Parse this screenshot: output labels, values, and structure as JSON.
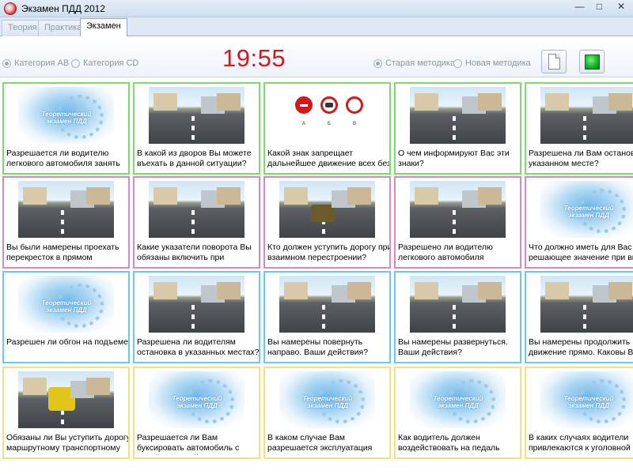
{
  "window": {
    "title": "Экзамен ПДД 2012"
  },
  "tabs": [
    {
      "label": "Теория",
      "active": false
    },
    {
      "label": "Практика",
      "active": false
    },
    {
      "label": "Экзамен",
      "active": true
    }
  ],
  "toolbar": {
    "category_ab": "Категория АВ",
    "category_cd": "Категория CD",
    "timer": "19:55",
    "method_old": "Старая методика",
    "method_new": "Новая методика",
    "doc_icon": "document-icon",
    "stop_icon": "green-square-icon"
  },
  "logo_text": "Теоретический экзамен ПДД",
  "sign_labels": [
    "А",
    "Б",
    "В"
  ],
  "row_colors": [
    "#7bdc6b",
    "#d58ac7",
    "#68c8ef",
    "#eee37e"
  ],
  "questions": [
    {
      "text": "Разрешается ли водителю легкового автомобиля занять",
      "pic": "logo"
    },
    {
      "text": "В какой из дворов Вы можете въехать в данной ситуации?",
      "pic": "road"
    },
    {
      "text": "Какой знак запрещает дальнейшее движение всех без",
      "pic": "signs"
    },
    {
      "text": "О чем информируют Вас эти знаки?",
      "pic": "road"
    },
    {
      "text": "Разрешена ли Вам остановка в указанном месте?",
      "pic": "road"
    },
    {
      "text": "Вы были намерены проехать перекресток в прямом",
      "pic": "road"
    },
    {
      "text": "Какие указатели поворота Вы обязаны включить при",
      "pic": "road"
    },
    {
      "text": "Кто должен уступить дорогу при взаимном перестроении?",
      "pic": "car"
    },
    {
      "text": "Разрешено ли водителю легкового автомобиля подъехать",
      "pic": "road"
    },
    {
      "text": "Что должно иметь для Вас решающее значение при выбо",
      "pic": "logo"
    },
    {
      "text": "Разрешен ли обгон на подъеме?",
      "pic": "logo"
    },
    {
      "text": "Разрешена ли водителям остановка в указанных местах?",
      "pic": "road"
    },
    {
      "text": "Вы намерены повернуть направо. Ваши действия?",
      "pic": "road"
    },
    {
      "text": "Вы намерены развернуться. Ваши действия?",
      "pic": "road"
    },
    {
      "text": "Вы намерены продолжить движение прямо. Каковы Ваш",
      "pic": "road"
    },
    {
      "text": "Обязаны ли Вы уступить дорогу маршрутному транспортному",
      "pic": "bus"
    },
    {
      "text": "Разрешается ли Вам буксировать автомобиль с недействующей",
      "pic": "logo"
    },
    {
      "text": "В каком случае Вам разрешается эксплуатация автомобиля?",
      "pic": "logo"
    },
    {
      "text": "Как водитель должен воздействовать на педаль",
      "pic": "logo"
    },
    {
      "text": "В каких случаях водители привлекаются к уголовной",
      "pic": "logo"
    }
  ]
}
